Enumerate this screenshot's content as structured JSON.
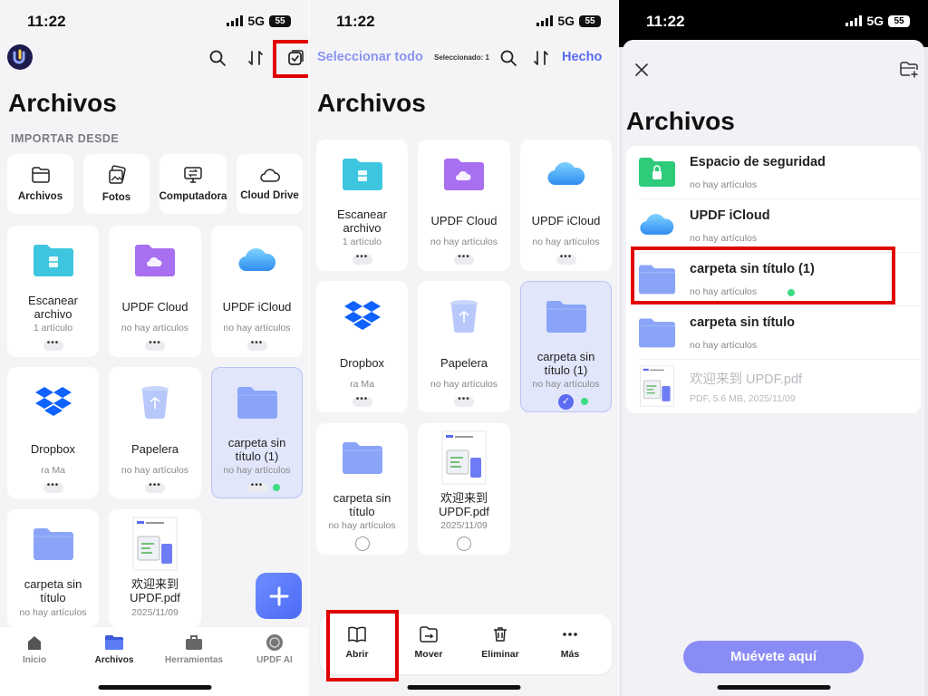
{
  "status": {
    "time": "11:22",
    "network": "5G",
    "battery": "55"
  },
  "panel1": {
    "title": "Archivos",
    "import_section": "IMPORTAR DESDE",
    "import": [
      {
        "label": "Archivos",
        "icon": "folder-outline-icon"
      },
      {
        "label": "Fotos",
        "icon": "photos-icon"
      },
      {
        "label": "Computadora",
        "icon": "computer-icon"
      },
      {
        "label": "Cloud Drive",
        "icon": "cloud-outline-icon"
      }
    ],
    "cards": [
      {
        "name": "Escanear archivo",
        "sub": "1 artículo"
      },
      {
        "name": "UPDF Cloud",
        "sub": "no hay artículos"
      },
      {
        "name": "UPDF iCloud",
        "sub": "no hay artículos"
      },
      {
        "name": "Dropbox",
        "sub": "ra Ma"
      },
      {
        "name": "Papelera",
        "sub": "no hay artículos"
      },
      {
        "name": "carpeta sin título (1)",
        "sub": "no hay artículos"
      },
      {
        "name": "carpeta sin título",
        "sub": "no hay artículos"
      },
      {
        "name": "欢迎来到 UPDF.pdf",
        "sub": "2025/11/09"
      }
    ],
    "tabs": [
      {
        "label": "Inicio",
        "icon": "home-icon"
      },
      {
        "label": "Archivos",
        "icon": "files-icon"
      },
      {
        "label": "Herramientas",
        "icon": "tools-icon"
      },
      {
        "label": "UPDF AI",
        "icon": "ai-icon"
      }
    ]
  },
  "panel2": {
    "select_all": "Seleccionar todo",
    "selected": "Seleccionado: 1",
    "done": "Hecho",
    "title": "Archivos",
    "cards": [
      {
        "name": "Escanear archivo",
        "sub": "1 artículo"
      },
      {
        "name": "UPDF Cloud",
        "sub": "no hay artículos"
      },
      {
        "name": "UPDF iCloud",
        "sub": "no hay artículos"
      },
      {
        "name": "Dropbox",
        "sub": "ra Ma"
      },
      {
        "name": "Papelera",
        "sub": "no hay artículos"
      },
      {
        "name": "carpeta sin título (1)",
        "sub": "no hay artículos"
      },
      {
        "name": "carpeta sin título",
        "sub": "no hay artículos"
      },
      {
        "name": "欢迎来到 UPDF.pdf",
        "sub": "2025/11/09"
      }
    ],
    "actions": [
      {
        "label": "Abrir",
        "icon": "book-open-icon"
      },
      {
        "label": "Mover",
        "icon": "folder-move-icon"
      },
      {
        "label": "Eliminar",
        "icon": "trash-icon"
      },
      {
        "label": "Más",
        "icon": "more-horizontal-icon"
      }
    ]
  },
  "panel3": {
    "title": "Archivos",
    "rows": [
      {
        "name": "Espacio de seguridad",
        "sub": "no hay artículos"
      },
      {
        "name": "UPDF iCloud",
        "sub": "no hay artículos"
      },
      {
        "name": "carpeta sin título (1)",
        "sub": "no hay artículos"
      },
      {
        "name": "carpeta sin título",
        "sub": "no hay artículos"
      },
      {
        "name": "欢迎来到 UPDF.pdf",
        "sub": "PDF, 5.6 MB, 2025/11/09"
      }
    ],
    "move_button": "Muévete aquí"
  },
  "colors": {
    "accent": "#5b6cf0",
    "highlight": "#e10000",
    "folder": "#8aa5f7",
    "cyan_folder": "#3ec6e0",
    "purple_folder": "#a86ff0",
    "green_folder": "#2ecb7a"
  }
}
